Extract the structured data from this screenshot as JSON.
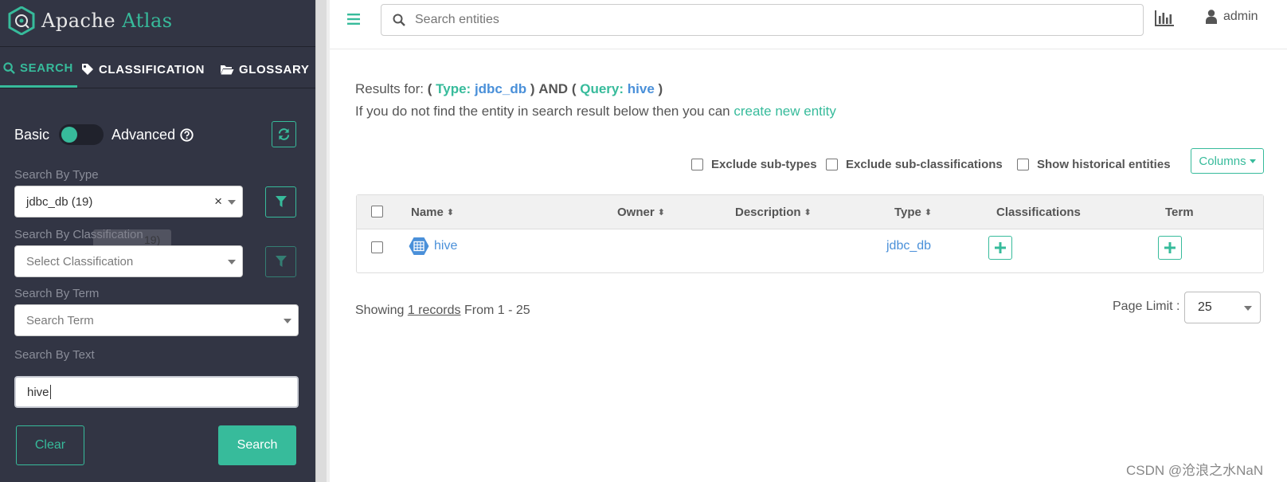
{
  "brand": {
    "apache": "Apache",
    "atlas": "Atlas"
  },
  "tabs": [
    {
      "label": "SEARCH",
      "icon": "search-icon",
      "active": true
    },
    {
      "label": "CLASSIFICATION",
      "icon": "tag-icon",
      "active": false
    },
    {
      "label": "GLOSSARY",
      "icon": "folder-open-icon",
      "active": false
    }
  ],
  "search_panel": {
    "basic_label": "Basic",
    "advanced_label": "Advanced",
    "type_label": "Search By Type",
    "type_value": "jdbc_db (19)",
    "type_clear": "×",
    "classification_label": "Search By Classification",
    "classification_placeholder": "Select Classification",
    "classification_tooltip": "19)",
    "term_label": "Search By Term",
    "term_placeholder": "Search Term",
    "text_label": "Search By Text",
    "text_value": "hive",
    "clear_button": "Clear",
    "search_button": "Search"
  },
  "header": {
    "search_placeholder": "Search entities",
    "user": "admin"
  },
  "results": {
    "prefix": "Results for:",
    "open1": "(",
    "type_key": "Type:",
    "type_val": "jdbc_db",
    "close1": ")",
    "and": "AND",
    "open2": "(",
    "query_key": "Query:",
    "query_val": "hive",
    "close2": ")",
    "hint": "If you do not find the entity in search result below then you can",
    "create_link": "create new entity"
  },
  "options": {
    "exclude_subtypes": "Exclude sub-types",
    "exclude_subclass": "Exclude sub-classifications",
    "show_historical": "Show historical entities",
    "columns": "Columns"
  },
  "table": {
    "headers": {
      "name": "Name",
      "owner": "Owner",
      "description": "Description",
      "type": "Type",
      "classifications": "Classifications",
      "term": "Term"
    },
    "sort_glyph": "⬍",
    "rows": [
      {
        "name": "hive",
        "owner": "",
        "description": "",
        "type": "jdbc_db"
      }
    ]
  },
  "pagination": {
    "showing": "Showing",
    "records": "1 records",
    "range": "From 1 - 25",
    "page_limit_label": "Page Limit :",
    "page_limit": "25"
  },
  "watermark": "CSDN @沧浪之水NaN",
  "colors": {
    "sidebar": "#323544",
    "accent": "#37bb9b",
    "link": "#4a90d9"
  }
}
